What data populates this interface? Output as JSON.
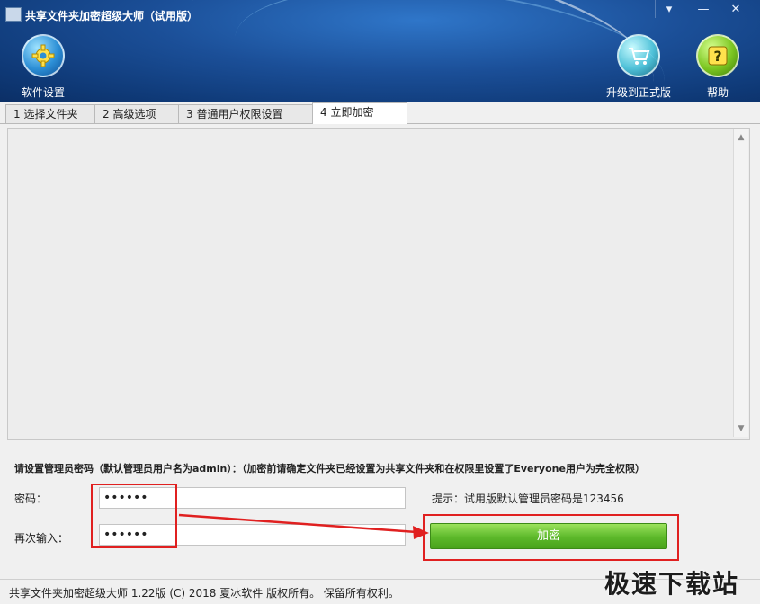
{
  "window": {
    "title": "共享文件夹加密超级大师（试用版）",
    "controls": {
      "menu": "▾",
      "minimize": "—",
      "close": "✕"
    }
  },
  "toolbar": {
    "settings_label": "软件设置",
    "upgrade_label": "升级到正式版",
    "help_label": "帮助"
  },
  "tabs": [
    {
      "label": "1 选择文件夹"
    },
    {
      "label": "2 高级选项"
    },
    {
      "label": "3 普通用户权限设置"
    },
    {
      "label": "4 立即加密",
      "active": true
    }
  ],
  "form": {
    "instruction": "请设置管理员密码（默认管理员用户名为admin）：（加密前请确定文件夹已经设置为共享文件夹和在权限里设置了Everyone用户为完全权限）",
    "password_label": "密码：",
    "password_value": "••••••",
    "confirm_label": "再次输入：",
    "confirm_value": "••••••",
    "hint": "提示：试用版默认管理员密码是123456",
    "encrypt_button": "加密"
  },
  "status_bar": {
    "text": "共享文件夹加密超级大师 1.22版 (C) 2018 夏冰软件 版权所有。 保留所有权利。"
  },
  "watermark": "极速下载站",
  "colors": {
    "header_blue": "#1b4f98",
    "button_green": "#5cb82a",
    "highlight_red": "#e02020"
  }
}
